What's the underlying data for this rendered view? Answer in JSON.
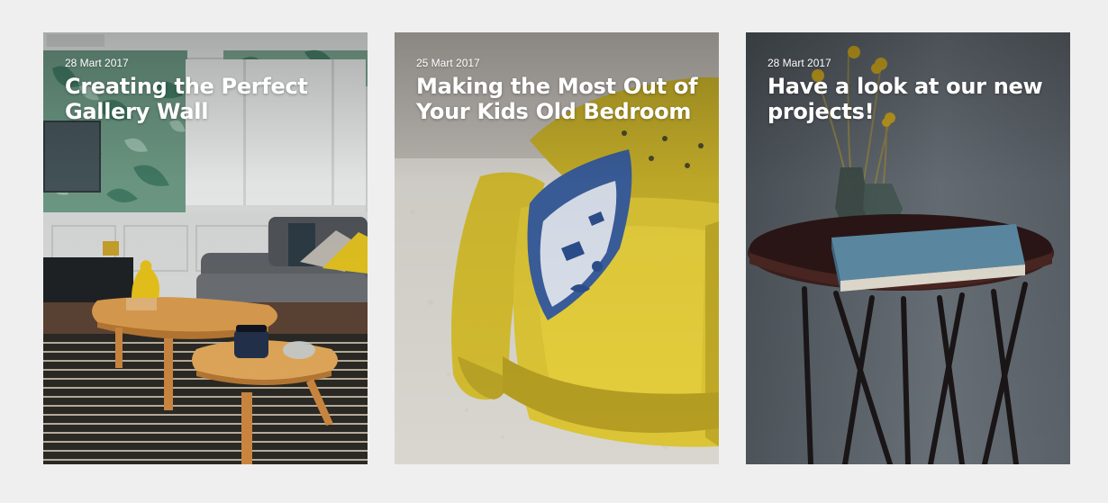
{
  "posts": [
    {
      "date": "28 Mart 2017",
      "title": "Creating the Perfect Gallery Wall",
      "image_subject": "living-room-coffee-tables"
    },
    {
      "date": "25 Mart 2017",
      "title": "Making the Most Out of Your Kids Old Bedroom",
      "image_subject": "yellow-armchair-with-pillow"
    },
    {
      "date": "28 Mart 2017",
      "title": "Have a look at our new projects!",
      "image_subject": "side-table-with-book-and-vases"
    }
  ],
  "colors": {
    "page_background": "#efefef",
    "text": "#ffffff",
    "armchair_yellow": "#d9c234",
    "pillow_yellow": "#e6c62b"
  }
}
